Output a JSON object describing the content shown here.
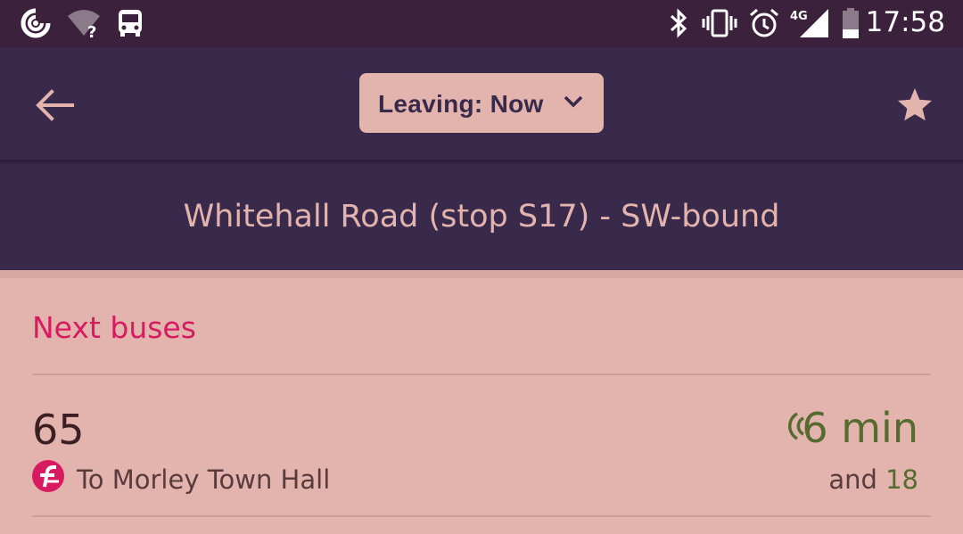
{
  "status_bar": {
    "time": "17:58",
    "network_type": "4G",
    "left_icons": [
      "data-saver-icon",
      "wifi-unknown-icon",
      "bus-notification-icon"
    ],
    "right_icons": [
      "bluetooth-icon",
      "vibrate-icon",
      "alarm-icon",
      "signal-4g-icon",
      "battery-icon"
    ]
  },
  "toolbar": {
    "back_icon": "arrow-left-icon",
    "leaving_label": "Leaving: Now",
    "leaving_icon": "chevron-down-icon",
    "favorite_icon": "star-icon"
  },
  "stop": {
    "name": "Whitehall Road (stop S17) - SW-bound"
  },
  "next_buses": {
    "title": "Next buses",
    "items": [
      {
        "route": "65",
        "operator_icon": "first-bus-logo-icon",
        "destination": "To Morley Town Hall",
        "eta": "6 min",
        "live": true,
        "and_label": "and",
        "next_after": "18"
      }
    ]
  },
  "colors": {
    "status_bar": "#3b213c",
    "app_bar": "#39294b",
    "background": "#e3b4ae",
    "accent_pink": "#d81b60",
    "eta_green": "#556b2f",
    "light_text": "#e3b4ae"
  }
}
